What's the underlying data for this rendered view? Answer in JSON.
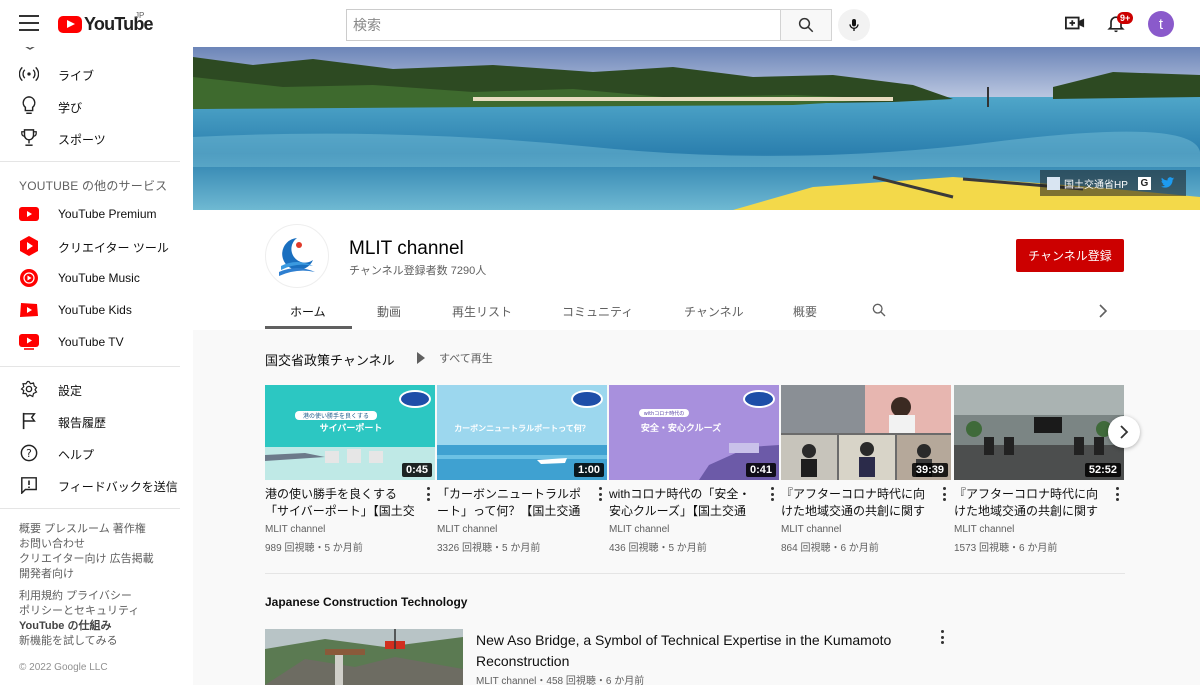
{
  "header": {
    "logo_text": "YouTube",
    "region": "JP",
    "search_placeholder": "検索",
    "notification_count": "9+",
    "avatar_letter": "t"
  },
  "sidebar": {
    "top_items": [
      {
        "label": "ライブ",
        "icon": "live-icon"
      },
      {
        "label": "学び",
        "icon": "lightbulb-icon"
      },
      {
        "label": "スポーツ",
        "icon": "trophy-icon"
      }
    ],
    "services_heading": "YOUTUBE の他のサービス",
    "services": [
      {
        "label": "YouTube Premium",
        "icon": "youtube-premium-icon"
      },
      {
        "label": "クリエイター ツール",
        "icon": "creator-tools-icon"
      },
      {
        "label": "YouTube Music",
        "icon": "youtube-music-icon"
      },
      {
        "label": "YouTube Kids",
        "icon": "youtube-kids-icon"
      },
      {
        "label": "YouTube TV",
        "icon": "youtube-tv-icon"
      }
    ],
    "settings_items": [
      {
        "label": "設定",
        "icon": "gear-icon"
      },
      {
        "label": "報告履歴",
        "icon": "flag-icon"
      },
      {
        "label": "ヘルプ",
        "icon": "help-icon"
      },
      {
        "label": "フィードバックを送信",
        "icon": "feedback-icon"
      }
    ],
    "footer1": [
      "概要  プレスルーム  著作権",
      "お問い合わせ",
      "クリエイター向け  広告掲載",
      "開発者向け"
    ],
    "footer2": [
      "利用規約  プライバシー",
      "ポリシーとセキュリティ",
      "YouTube の仕組み",
      "新機能を試してみる"
    ],
    "copyright": "© 2022 Google LLC"
  },
  "banner": {
    "link_label": "国土交通省HP",
    "g_label": "G"
  },
  "channel": {
    "name": "MLIT channel",
    "subscribers": "チャンネル登録者数 7290人",
    "subscribe_label": "チャンネル登録",
    "tabs": [
      "ホーム",
      "動画",
      "再生リスト",
      "コミュニティ",
      "チャンネル",
      "概要"
    ]
  },
  "section1": {
    "title": "国交省政策チャンネル",
    "play_all": "すべて再生",
    "videos": [
      {
        "title": "港の使い勝手を良くする「サイバーポート」【国土交通...",
        "channel": "MLIT channel",
        "meta": "989 回視聴・5 か月前",
        "duration": "0:45",
        "thumb_text": "サイバーポート",
        "thumb_sub": "港の使い勝手を良くする"
      },
      {
        "title": "「カーボンニュートラルポート」って何？【国土交通省...",
        "channel": "MLIT channel",
        "meta": "3326 回視聴・5 か月前",
        "duration": "1:00",
        "thumb_text": "カーボンニュートラルポートって何？",
        "thumb_sub": ""
      },
      {
        "title": "withコロナ時代の「安全・安心クルーズ」【国土交通省...",
        "channel": "MLIT channel",
        "meta": "436 回視聴・5 か月前",
        "duration": "0:41",
        "thumb_text": "安全・安心クルーズ",
        "thumb_sub": "withコロナ時代の"
      },
      {
        "title": "『アフターコロナ時代に向けた地域交通の共創に関する...",
        "channel": "MLIT channel",
        "meta": "864 回視聴・6 か月前",
        "duration": "39:39",
        "thumb_text": "",
        "thumb_sub": ""
      },
      {
        "title": "『アフターコロナ時代に向けた地域交通の共創に関する...",
        "channel": "MLIT channel",
        "meta": "1573 回視聴・6 か月前",
        "duration": "52:52",
        "thumb_text": "",
        "thumb_sub": ""
      }
    ]
  },
  "section2": {
    "title": "Japanese Construction Technology",
    "video": {
      "title": "New Aso Bridge, a Symbol of Technical Expertise in the Kumamoto Reconstruction",
      "meta": "MLIT channel・458 回視聴・6 か月前"
    }
  }
}
